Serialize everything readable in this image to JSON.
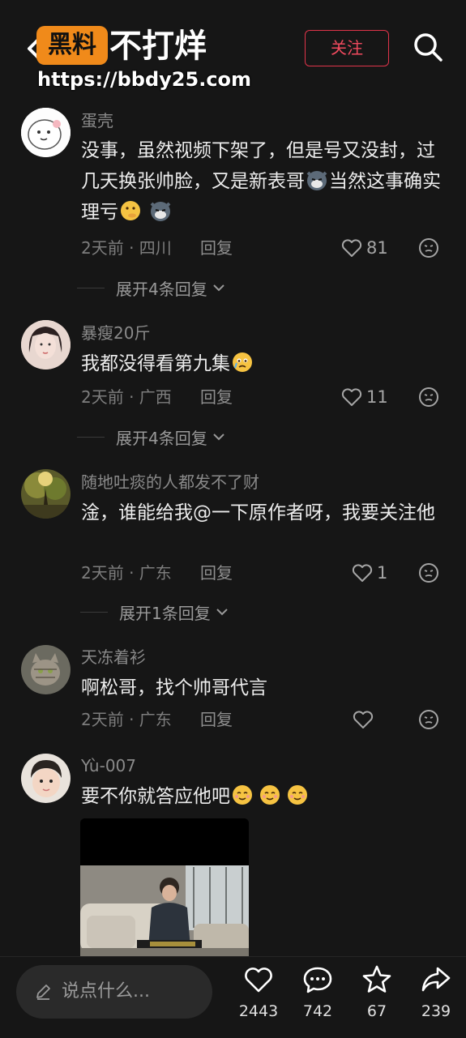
{
  "header": {
    "logo_text": "黑料",
    "title": "不打烊",
    "watermark": "https://bbdy25.com",
    "follow_label": "关注"
  },
  "comments": [
    {
      "username": "蛋壳",
      "text_parts": [
        "没事，虽然视频下架了，但是号又没封，过几天换张帅脸，又是新表哥",
        "当然这事确实理亏"
      ],
      "meta": "2天前 · 四川",
      "reply_label": "回复",
      "likes": "81",
      "expand_label": "展开4条回复"
    },
    {
      "username": "暴瘦20斤",
      "text": "我都没得看第九集",
      "meta": "2天前 · 广西",
      "reply_label": "回复",
      "likes": "11",
      "expand_label": "展开4条回复"
    },
    {
      "username": "随地吐痰的人都发不了财",
      "text": "淦，谁能给我@一下原作者呀，我要关注他",
      "meta": "2天前 · 广东",
      "reply_label": "回复",
      "likes": "1",
      "expand_label": "展开1条回复"
    },
    {
      "username": "天冻着衫",
      "text": "啊松哥，找个帅哥代言",
      "meta": "2天前 · 广东",
      "reply_label": "回复",
      "likes": ""
    },
    {
      "username": "Yù-007",
      "text": "要不你就答应他吧"
    }
  ],
  "bottom": {
    "input_placeholder": "说点什么...",
    "like_count": "2443",
    "comment_count": "742",
    "star_count": "67",
    "share_count": "239"
  }
}
